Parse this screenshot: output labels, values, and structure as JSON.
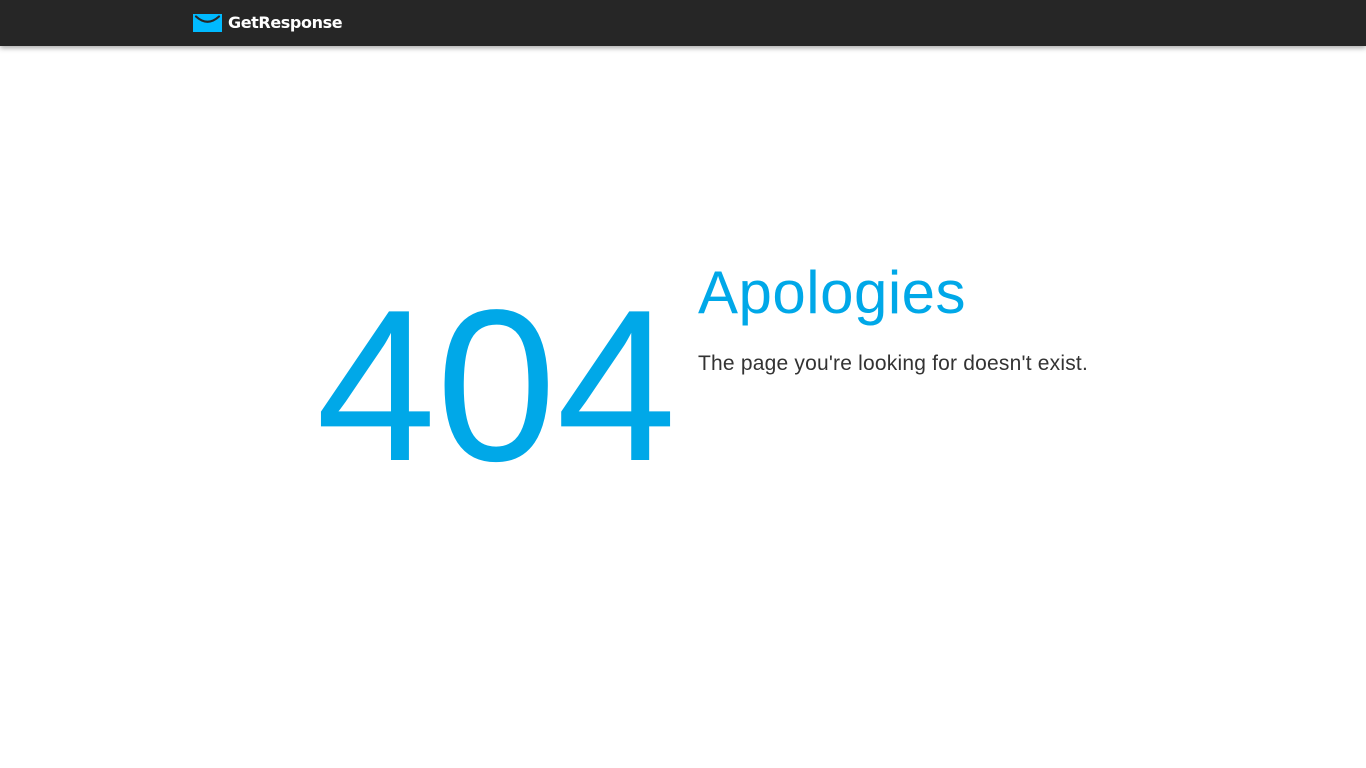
{
  "header": {
    "logo_text": "GetResponse",
    "logo_icon": "envelope-icon",
    "background_color": "#262626"
  },
  "error": {
    "code": "404",
    "title": "Apologies",
    "message": "The page you're looking for doesn't exist.",
    "accent_color": "#00a8e8",
    "text_color": "#333333"
  }
}
